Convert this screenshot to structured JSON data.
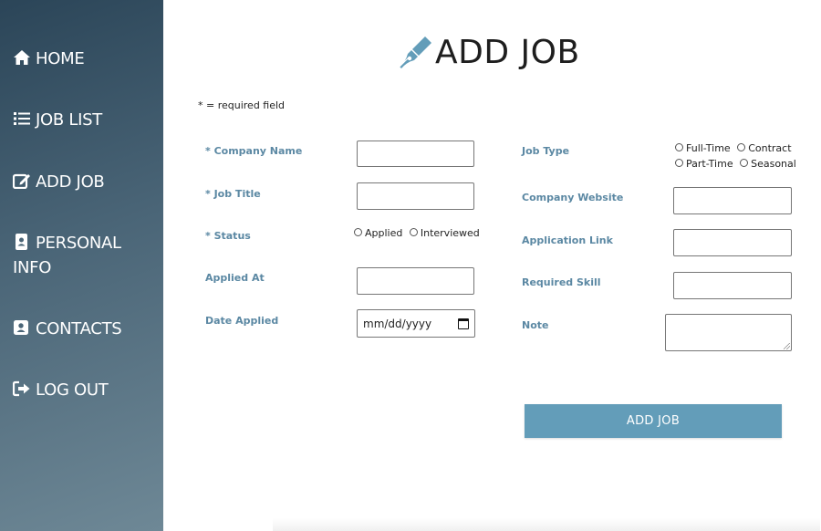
{
  "sidebar": {
    "items": [
      {
        "label": "HOME",
        "icon": "home-icon"
      },
      {
        "label": "JOB LIST",
        "icon": "list-icon"
      },
      {
        "label": "ADD JOB",
        "icon": "edit-icon"
      },
      {
        "label": "PERSONAL INFO",
        "icon": "id-card-icon"
      },
      {
        "label": "CONTACTS",
        "icon": "contact-icon"
      },
      {
        "label": "LOG OUT",
        "icon": "logout-icon"
      }
    ]
  },
  "page": {
    "title": "ADD JOB",
    "required_note": "* = required field"
  },
  "form": {
    "company_name_label": "* Company Name",
    "job_title_label": "* Job Title",
    "status_label": "* Status",
    "status_options": [
      "Applied",
      "Interviewed"
    ],
    "applied_at_label": "Applied At",
    "date_applied_label": "Date Applied",
    "date_placeholder": "mm/dd/yyyy",
    "job_type_label": "Job Type",
    "job_type_options": [
      "Full-Time",
      "Contract",
      "Part-Time",
      "Seasonal"
    ],
    "company_website_label": "Company Website",
    "application_link_label": "Application Link",
    "required_skill_label": "Required Skill",
    "note_label": "Note",
    "submit_label": "ADD JOB"
  },
  "colors": {
    "accent": "#639db9",
    "label": "#5b88a3",
    "sidebar_dark": "#2b4558",
    "sidebar_light": "#6e8896"
  }
}
